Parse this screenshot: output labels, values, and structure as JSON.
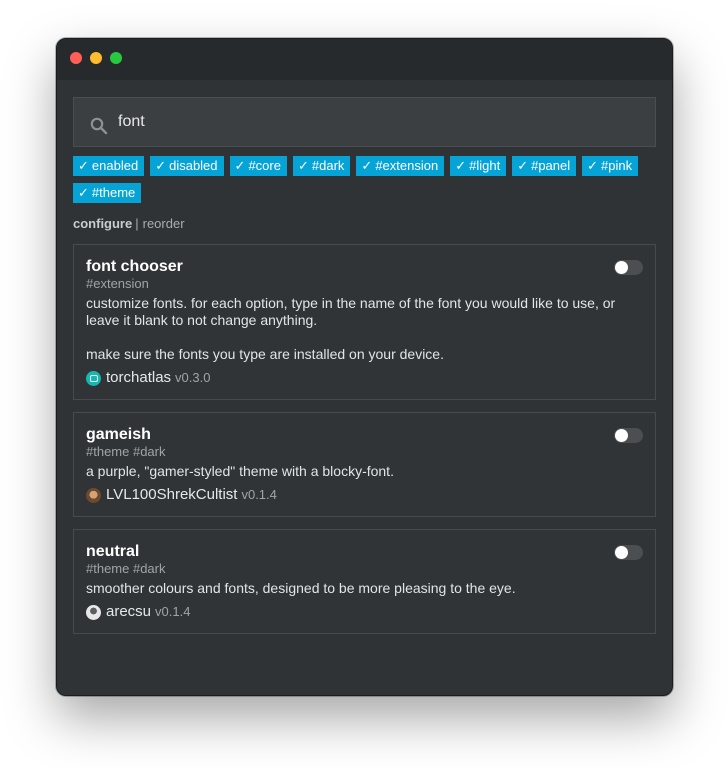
{
  "window": {
    "controls": [
      "close",
      "minimize",
      "maximize"
    ]
  },
  "search": {
    "value": "font",
    "icon": "search-icon"
  },
  "filters": [
    {
      "label": "enabled",
      "checked": true
    },
    {
      "label": "disabled",
      "checked": true
    },
    {
      "label": "#core",
      "checked": true
    },
    {
      "label": "#dark",
      "checked": true
    },
    {
      "label": "#extension",
      "checked": true
    },
    {
      "label": "#light",
      "checked": true
    },
    {
      "label": "#panel",
      "checked": true
    },
    {
      "label": "#pink",
      "checked": true
    },
    {
      "label": "#theme",
      "checked": true
    }
  ],
  "filter_check": "✓",
  "modes": {
    "active": "configure",
    "separator": "|",
    "other": "reorder"
  },
  "extensions": [
    {
      "title": "font chooser",
      "tags": "#extension",
      "description": [
        "customize fonts. for each option, type in the name of the font you would like to use, or leave it blank to not change anything.",
        "make sure the fonts you type are installed on your device."
      ],
      "author": "torchatlas",
      "version": "v0.3.0",
      "enabled": false
    },
    {
      "title": "gameish",
      "tags": "#theme #dark",
      "description": [
        "a purple, \"gamer-styled\" theme with a blocky-font."
      ],
      "author": "LVL100ShrekCultist",
      "version": "v0.1.4",
      "enabled": false
    },
    {
      "title": "neutral",
      "tags": "#theme #dark",
      "description": [
        "smoother colours and fonts, designed to be more pleasing to the eye."
      ],
      "author": "arecsu",
      "version": "v0.1.4",
      "enabled": false
    }
  ],
  "colors": {
    "accent": "#06a3d6",
    "window_bg": "#2f3336",
    "titlebar_bg": "#272a2c",
    "card_border": "#474b4e",
    "close": "#ff5f57",
    "minimize": "#febc2e",
    "maximize": "#28c840"
  }
}
